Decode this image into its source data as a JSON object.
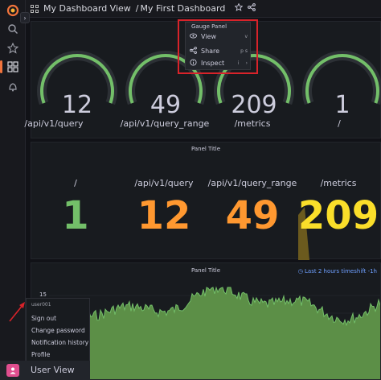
{
  "colors": {
    "bg": "#111217",
    "panel": "#181b1f",
    "green": "#73bf69",
    "orange": "#ff9830",
    "yellow": "#fade2a",
    "accent": "#f2743c",
    "red": "#d8232a",
    "track": "#2c3035"
  },
  "topbar": {
    "dashboards_folder": "My Dashboard View",
    "separator": "/",
    "dashboard_title": "My First Dashboard"
  },
  "sidebar": {
    "icons": [
      "grafana-logo-icon",
      "search-icon",
      "star-icon",
      "dashboards-icon",
      "alerting-icon"
    ]
  },
  "gauges": [
    {
      "value": "12",
      "label": "/api/v1/query",
      "fraction": 1.0
    },
    {
      "value": "49",
      "label": "/api/v1/query_range",
      "fraction": 1.0
    },
    {
      "value": "209",
      "label": "/metrics",
      "fraction": 1.0
    },
    {
      "value": "1",
      "label": "/",
      "fraction": 1.0
    }
  ],
  "gauge_menu": {
    "title": "Gauge Panel",
    "items": [
      {
        "label": "View",
        "shortcut": "v",
        "icon": "eye-icon"
      },
      {
        "label": "Share",
        "shortcut": "p s",
        "icon": "share-icon"
      },
      {
        "label": "Inspect",
        "shortcut": "i",
        "icon": "info-icon"
      }
    ]
  },
  "stat_panel": {
    "title": "Panel Title",
    "stats": [
      {
        "label": "/",
        "value": "1",
        "color": "#73bf69"
      },
      {
        "label": "/api/v1/query",
        "value": "12",
        "color": "#ff9830"
      },
      {
        "label": "/api/v1/query_range",
        "value": "49",
        "color": "#ff9830"
      },
      {
        "label": "/metrics",
        "value": "209",
        "color": "#fade2a"
      }
    ]
  },
  "timeseries_panel": {
    "title": "Panel Title",
    "time_shift": "Last 2 hours timeshift -1h",
    "y_tick": "15"
  },
  "user_menu": {
    "username": "user001",
    "items": [
      "Sign out",
      "Change password",
      "Notification history",
      "Profile"
    ],
    "footer_label": "User View"
  }
}
